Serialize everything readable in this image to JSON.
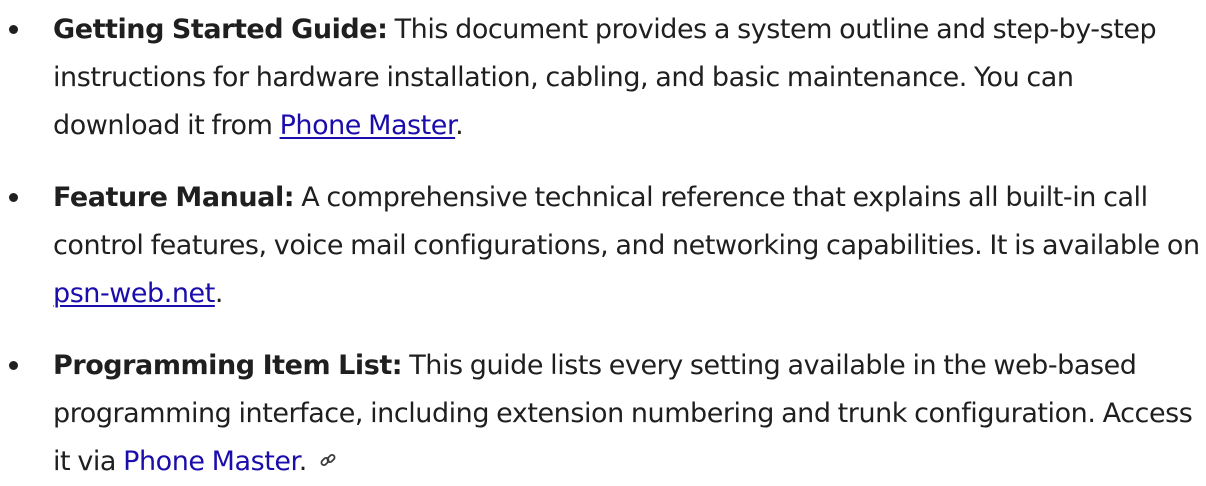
{
  "items": [
    {
      "term": "Getting Started Guide:",
      "text": " This document provides a system outline and step-by-step instructions for hardware installation, cabling, and basic maintenance. You can download it from ",
      "link": "Phone Master",
      "after": "."
    },
    {
      "term": "Feature Manual:",
      "text": " A comprehensive technical reference that explains all built-in call control features, voice mail configurations, and networking capabilities. It is available on ",
      "link": "psn-web.net",
      "after": "."
    },
    {
      "term": "Programming Item List:",
      "text": " This guide lists every setting available in the web-based programming interface, including extension numbering and trunk configuration. Access it via ",
      "link": "Phone Master",
      "after": "."
    }
  ],
  "icons": {
    "link_icon": "link-icon"
  },
  "colors": {
    "text": "#1f1f1f",
    "link": "#1a0dab"
  }
}
